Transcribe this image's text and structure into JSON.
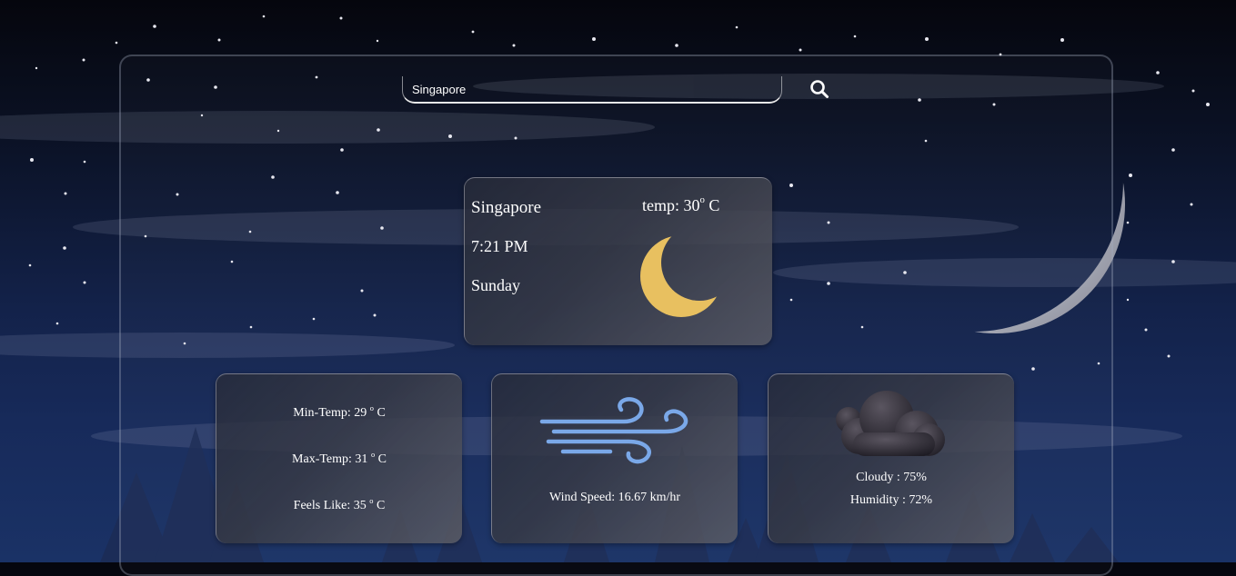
{
  "search": {
    "value": "Singapore",
    "icon": "search-icon"
  },
  "current": {
    "city": "Singapore",
    "time": "7:21 PM",
    "day": "Sunday",
    "temp_prefix": "temp: 30",
    "temp_unit": "C",
    "icon": "crescent-moon-icon",
    "icon_color": "#e8c060"
  },
  "stats": {
    "min_temp_prefix": "Min-Temp: 29",
    "max_temp_prefix": "Max-Temp: 31",
    "feels_like_prefix": "Feels Like: 35",
    "unit": "C",
    "degree": "o"
  },
  "wind": {
    "label": "Wind Speed: 16.67 km/hr",
    "icon": "wind-icon",
    "icon_color": "#7aa8e8"
  },
  "clouds": {
    "cloudy": "Cloudy : 75%",
    "humidity": "Humidity : 72%",
    "icon": "cloud-icon"
  }
}
